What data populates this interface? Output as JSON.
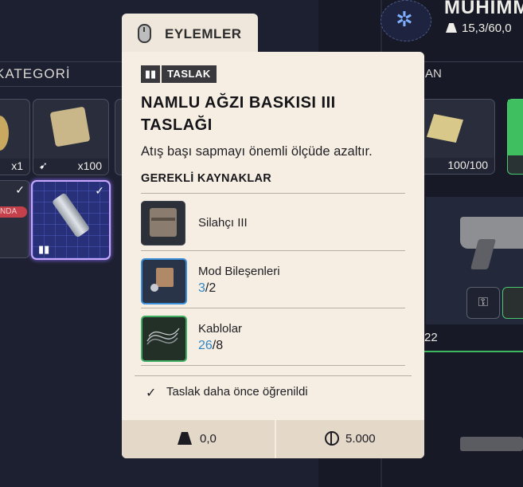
{
  "background": {
    "category_header": "KATEGORİ",
    "right_header": "AN",
    "top_title": "MUHİMM",
    "top_weight": "15,3/60,0",
    "slots": [
      {
        "qty": "x1"
      },
      {
        "qty": "x100"
      },
      {
        "qty": "100/100"
      }
    ],
    "red_tag": "NDA",
    "right_count": "22"
  },
  "actions_tab": {
    "label": "EYLEMLER"
  },
  "tooltip": {
    "badge": "TASLAK",
    "title": "NAMLU AĞZI BASKISI III TASLAĞI",
    "description": "Atış başı sapmayı önemli ölçüde azaltır.",
    "requirements_header": "GEREKLİ KAYNAKLAR",
    "requirements": [
      {
        "name": "Silahçı III",
        "have": "",
        "sep": "",
        "need": "",
        "icon": "workbench-icon"
      },
      {
        "name": "Mod Bileşenleri",
        "have": "3",
        "sep": "/",
        "need": "2",
        "icon": "mod-components-icon"
      },
      {
        "name": "Kablolar",
        "have": "26",
        "sep": "/",
        "need": "8",
        "icon": "cables-icon"
      }
    ],
    "learned_text": "Taslak daha önce öğrenildi",
    "weight": "0,0",
    "price": "5.000"
  },
  "colors": {
    "panel_bg": "#f6eee2",
    "footer_bg": "#e4d8c9",
    "have_blue": "#2f86c6",
    "accent_green": "#3fb760"
  }
}
